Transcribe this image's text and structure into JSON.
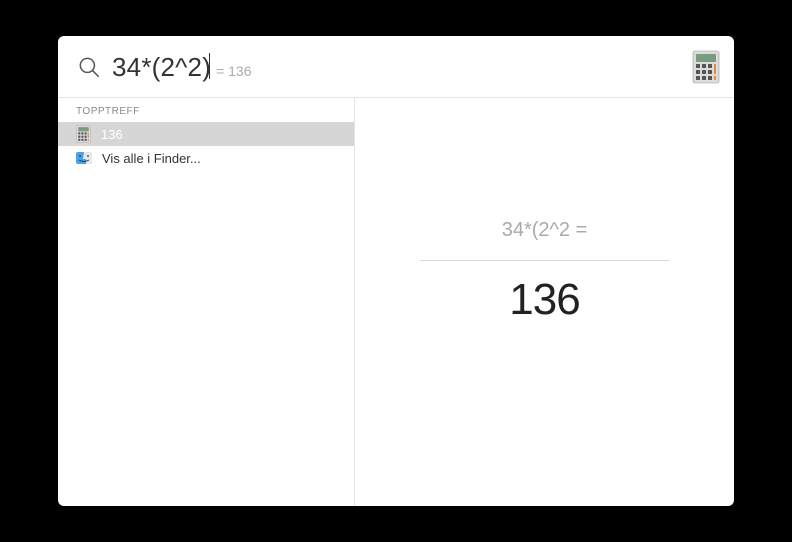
{
  "search": {
    "query": "34*(2^2)",
    "inline_result": "= 136"
  },
  "sidebar": {
    "section_label": "TOPPTREFF",
    "items": [
      {
        "label": "136"
      },
      {
        "label": "Vis alle i Finder..."
      }
    ]
  },
  "preview": {
    "expression": "34*(2^2 =",
    "result": "136"
  }
}
